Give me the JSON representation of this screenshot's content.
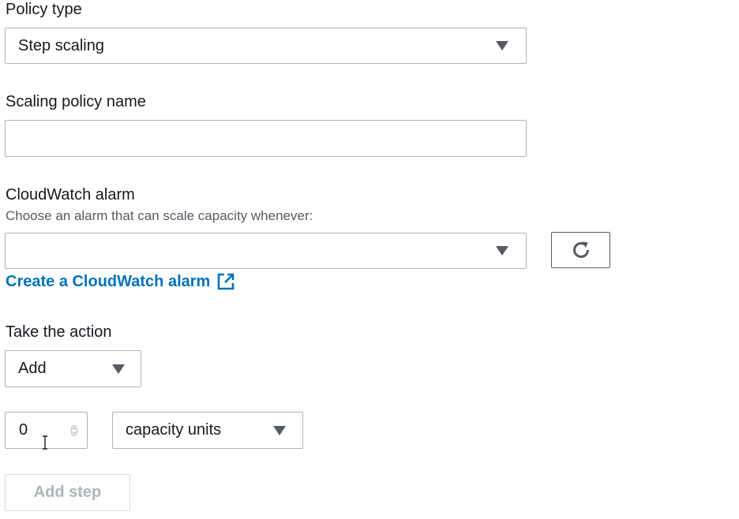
{
  "policy_type": {
    "label": "Policy type",
    "selected": "Step scaling"
  },
  "policy_name": {
    "label": "Scaling policy name",
    "value": ""
  },
  "cloudwatch_alarm": {
    "label": "CloudWatch alarm",
    "description": "Choose an alarm that can scale capacity whenever:",
    "selected": "",
    "refresh_icon": "refresh-icon",
    "create_link": "Create a CloudWatch alarm",
    "external_icon": "external-link-icon"
  },
  "action": {
    "label": "Take the action",
    "selected": "Add",
    "amount": "0",
    "unit": "capacity units"
  },
  "add_step": {
    "label": "Add step"
  },
  "colors": {
    "link": "#0073bb",
    "text": "#16191f",
    "secondary_text": "#545b64",
    "border": "#aab7b8",
    "disabled": "#aab7b8"
  }
}
